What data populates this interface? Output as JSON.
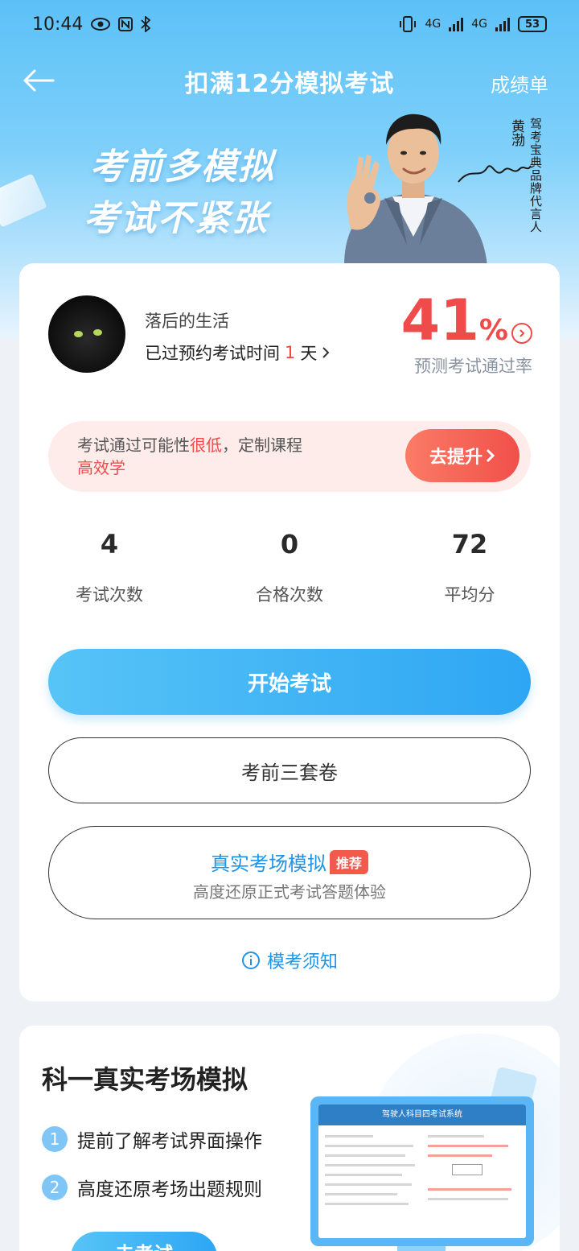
{
  "status_bar": {
    "time": "10:44",
    "battery": "53",
    "net1": "4G",
    "net2": "4G"
  },
  "nav": {
    "title": "扣满12分模拟考试",
    "right_link": "成绩单"
  },
  "hero": {
    "slogan_line1": "考前多模拟",
    "slogan_line2": "考试不紧张",
    "spokesman_name": "黄渤",
    "spokesman_title": "驾考宝典品牌代言人"
  },
  "user": {
    "name": "落后的生活",
    "exam_time_prefix": "已过预约考试时间",
    "days": "1",
    "days_unit": "天"
  },
  "pass_rate": {
    "value": "41",
    "unit": "%",
    "label": "预测考试通过率"
  },
  "promo": {
    "text_prefix": "考试通过可能性",
    "text_highlight": "很低",
    "text_suffix": "，定制课程",
    "text_line2": "高效学",
    "button": "去提升"
  },
  "stats": [
    {
      "value": "4",
      "label": "考试次数"
    },
    {
      "value": "0",
      "label": "合格次数"
    },
    {
      "value": "72",
      "label": "平均分"
    }
  ],
  "actions": {
    "start": "开始考试",
    "three_sets": "考前三套卷",
    "real_title": "真实考场模拟",
    "real_badge": "推荐",
    "real_sub": "高度还原正式考试答题体验",
    "notice": "模考须知"
  },
  "section2": {
    "title": "科一真实考场模拟",
    "features": [
      {
        "num": "1",
        "text": "提前了解考试界面操作"
      },
      {
        "num": "2",
        "text": "高度还原考场出题规则"
      }
    ],
    "button": "去考试",
    "screen_header": "驾驶人科目四考试系统"
  },
  "colors": {
    "accent_blue": "#2ea6f3",
    "rate_red": "#f04b4b",
    "link_blue": "#2194e6"
  }
}
